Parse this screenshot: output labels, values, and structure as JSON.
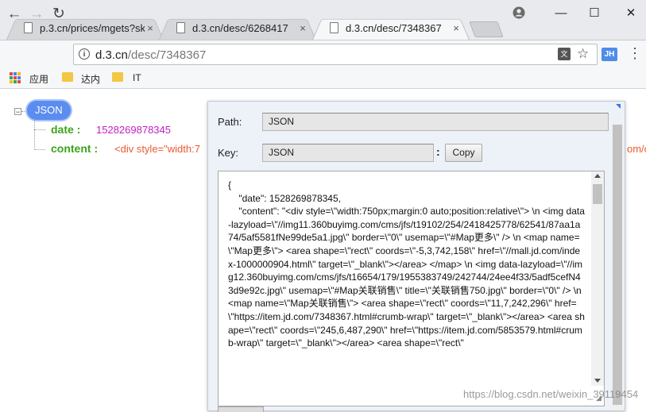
{
  "tabs": [
    {
      "label": "p.3.cn/prices/mgets?sk",
      "close": "×"
    },
    {
      "label": "d.3.cn/desc/6268417",
      "close": "×"
    },
    {
      "label": "d.3.cn/desc/7348367",
      "close": "×"
    }
  ],
  "window_controls": {
    "minimize": "—",
    "maximize": "☐",
    "close": "✕"
  },
  "toolbar": {
    "back": "←",
    "forward": "→",
    "reload": "↻",
    "url_host": "d.3.cn",
    "url_path": "/desc/7348367",
    "info_glyph": "i",
    "translate_glyph": "文",
    "star_glyph": "☆",
    "extension_label": "JH",
    "menu_glyph": "⋮"
  },
  "bookmarks": [
    {
      "label": "应用",
      "icon": "apps-icon"
    },
    {
      "label": "达内",
      "icon": "folder-icon"
    },
    {
      "label": "IT",
      "icon": "folder-icon"
    }
  ],
  "tree": {
    "root_label": "JSON",
    "collapse_glyph": "−",
    "items": [
      {
        "key": "date :",
        "value": "1528269878345"
      },
      {
        "key": "content :",
        "value": "<div style=\"width:7"
      }
    ],
    "overflow_text": "om/c"
  },
  "panel": {
    "path_label": "Path:",
    "path_value": "JSON",
    "key_label": "Key:",
    "key_value": "JSON",
    "colon": ":",
    "copy_label": "Copy",
    "json_text": "{\n    \"date\": 1528269878345,\n    \"content\": \"<div style=\\\"width:750px;margin:0 auto;position:relative\\\"> \\n <img data-lazyload=\\\"//img11.360buyimg.com/cms/jfs/t19102/254/2418425778/62541/87aa1a74/5af5581fNe99de5a1.jpg\\\" border=\\\"0\\\" usemap=\\\"#Map更多\\\" /> \\n <map name=\\\"Map更多\\\"> <area shape=\\\"rect\\\" coords=\\\"-5,3,742,158\\\" href=\\\"//mall.jd.com/index-1000000904.html\\\" target=\\\"_blank\\\"></area> </map> \\n <img data-lazyload=\\\"//img12.360buyimg.com/cms/jfs/t16654/179/1955383749/242744/24ee4f33/5adf5cefN43d9e92c.jpg\\\" usemap=\\\"#Map关联销售\\\" title=\\\"关联销售750.jpg\\\" border=\\\"0\\\" /> \\n <map name=\\\"Map关联销售\\\"> <area shape=\\\"rect\\\" coords=\\\"11,7,242,296\\\" href=\\\"https://item.jd.com/7348367.html#crumb-wrap\\\" target=\\\"_blank\\\"></area> <area shape=\\\"rect\\\" coords=\\\"245,6,487,290\\\" href=\\\"https://item.jd.com/5853579.html#crumb-wrap\\\" target=\\\"_blank\\\"></area> <area shape=\\\"rect\\\""
  },
  "watermark": "https://blog.csdn.net/weixin_39119454",
  "colors": {
    "accent": "#5b8cf0",
    "key": "#3aa51a",
    "number": "#c41ec4",
    "string": "#ea5a2f"
  }
}
